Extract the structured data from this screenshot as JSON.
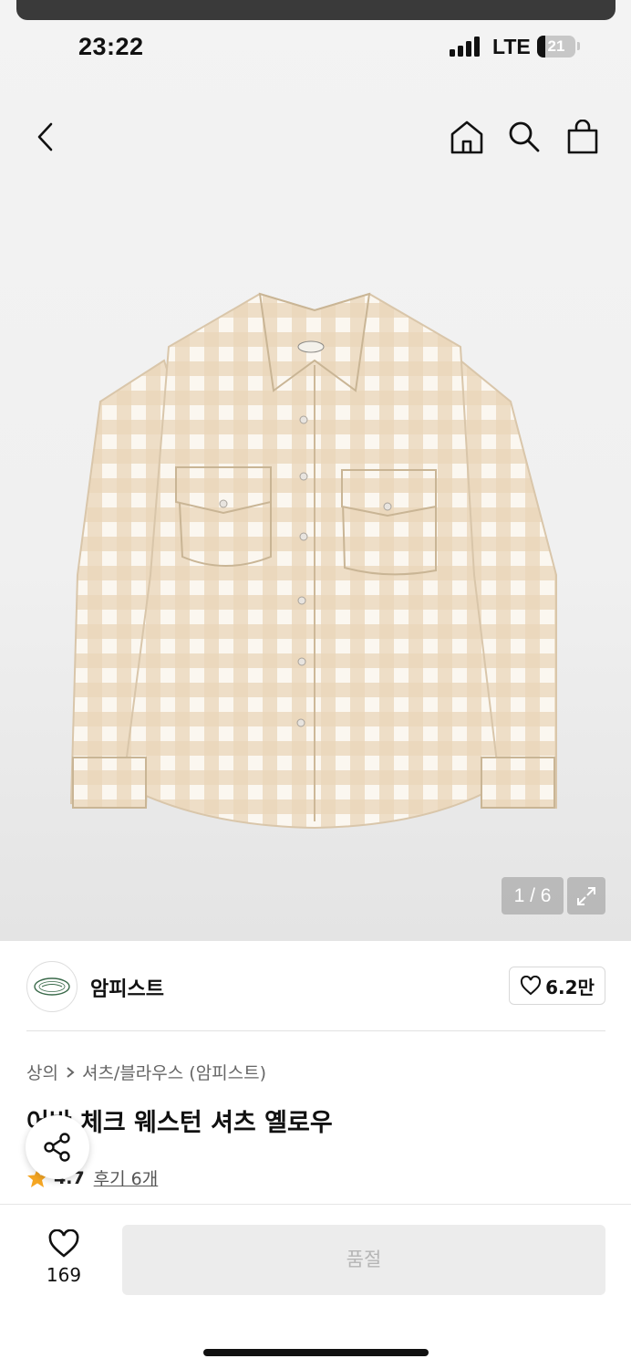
{
  "status_bar": {
    "time": "23:22",
    "network": "LTE",
    "battery": "21",
    "battery_level": 0.21
  },
  "nav": {
    "back_icon": "chevron-left-icon",
    "home_icon": "home-icon",
    "search_icon": "search-icon",
    "cart_icon": "shopping-bag-icon"
  },
  "gallery": {
    "pager": "1 / 6",
    "expand_icon": "expand-icon"
  },
  "brand": {
    "name": "암피스트",
    "likes": "6.2만"
  },
  "product": {
    "breadcrumb": [
      "상의",
      "셔츠/블라우스 (암피스트)"
    ],
    "title": "어반 체크 웨스턴 셔츠 옐로우",
    "rating": "4.7",
    "reviews": "후기 6개"
  },
  "actions": {
    "wish_count": "169",
    "soldout_label": "품절"
  },
  "colors": {
    "accent_star": "#f5a623",
    "soldout_bg": "#ececec",
    "soldout_text": "#b5b5b5"
  }
}
